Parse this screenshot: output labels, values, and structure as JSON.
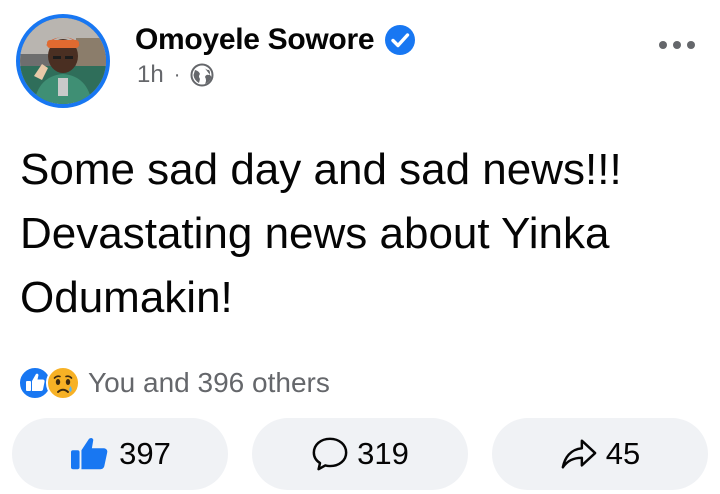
{
  "post": {
    "author": {
      "name": "Omoyele Sowore",
      "verified": true
    },
    "timestamp": "1h",
    "separator": "·",
    "audience_icon": "globe-icon",
    "text": "Some sad day and sad news!!! Devastating news about Yinka Odumakin!",
    "reactions": {
      "types": [
        "like",
        "sad"
      ],
      "summary": "You and 396 others"
    },
    "actions": {
      "like_count": "397",
      "comment_count": "319",
      "share_count": "45"
    }
  },
  "colors": {
    "brand_blue": "#1877f2",
    "secondary_text": "#65676b",
    "button_bg": "#f0f2f5",
    "sad_yellow": "#f7b125"
  }
}
